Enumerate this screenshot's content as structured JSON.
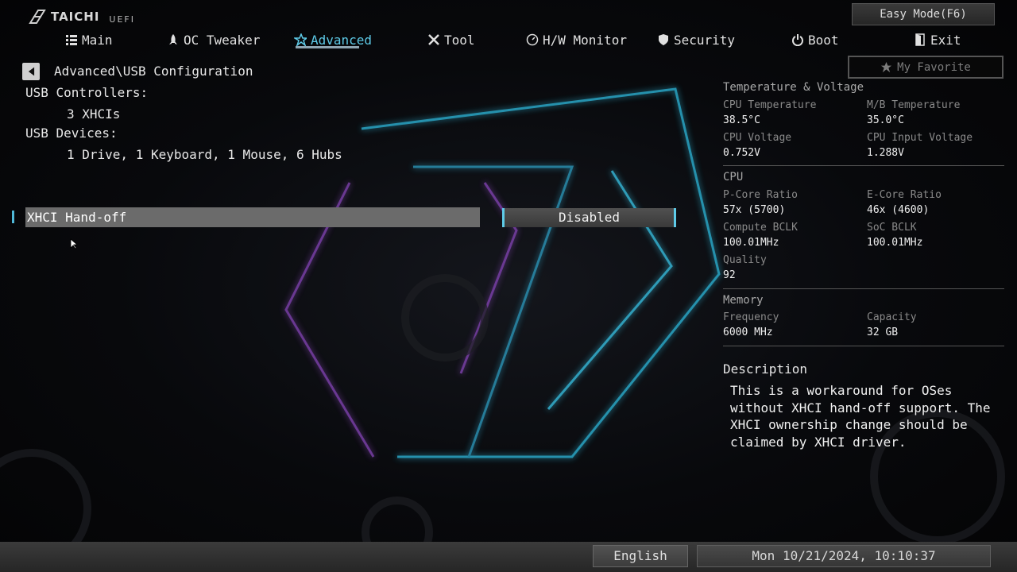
{
  "brand": {
    "name": "TAICHI",
    "product": "UEFI"
  },
  "easy_mode_label": "Easy Mode(F6)",
  "nav": {
    "main": "Main",
    "oc_tweaker": "OC Tweaker",
    "advanced": "Advanced",
    "tool": "Tool",
    "hw_monitor": "H/W Monitor",
    "security": "Security",
    "boot": "Boot",
    "exit": "Exit",
    "active": "Advanced"
  },
  "my_favorite_label": "My Favorite",
  "breadcrumb": "Advanced\\USB Configuration",
  "usb": {
    "controllers_label": "USB Controllers:",
    "controllers_value": "3 XHCIs",
    "devices_label": "USB Devices:",
    "devices_value": "1 Drive, 1 Keyboard, 1 Mouse, 6 Hubs"
  },
  "setting": {
    "label": "XHCI Hand-off",
    "value": "Disabled"
  },
  "monitor": {
    "temp_voltage_header": "Temperature & Voltage",
    "cpu_temp_label": "CPU Temperature",
    "cpu_temp_value": "38.5°C",
    "mb_temp_label": "M/B Temperature",
    "mb_temp_value": "35.0°C",
    "cpu_voltage_label": "CPU Voltage",
    "cpu_voltage_value": "0.752V",
    "cpu_input_voltage_label": "CPU Input Voltage",
    "cpu_input_voltage_value": "1.288V",
    "cpu_header": "CPU",
    "pcore_label": "P-Core Ratio",
    "pcore_value": "57x (5700)",
    "ecore_label": "E-Core Ratio",
    "ecore_value": "46x (4600)",
    "compute_bclk_label": "Compute BCLK",
    "compute_bclk_value": "100.01MHz",
    "soc_bclk_label": "SoC BCLK",
    "soc_bclk_value": "100.01MHz",
    "quality_label": "Quality",
    "quality_value": "92",
    "memory_header": "Memory",
    "frequency_label": "Frequency",
    "frequency_value": "6000 MHz",
    "capacity_label": "Capacity",
    "capacity_value": "32 GB"
  },
  "description": {
    "title": "Description",
    "body": "This is a workaround for OSes without XHCI hand-off support. The XHCI ownership change should be claimed by XHCI driver."
  },
  "language": "English",
  "datetime": "Mon 10/21/2024, 10:10:37",
  "colors": {
    "accent": "#5ecbe8",
    "highlight_row": "#6b6b6b",
    "background": "#050608"
  }
}
